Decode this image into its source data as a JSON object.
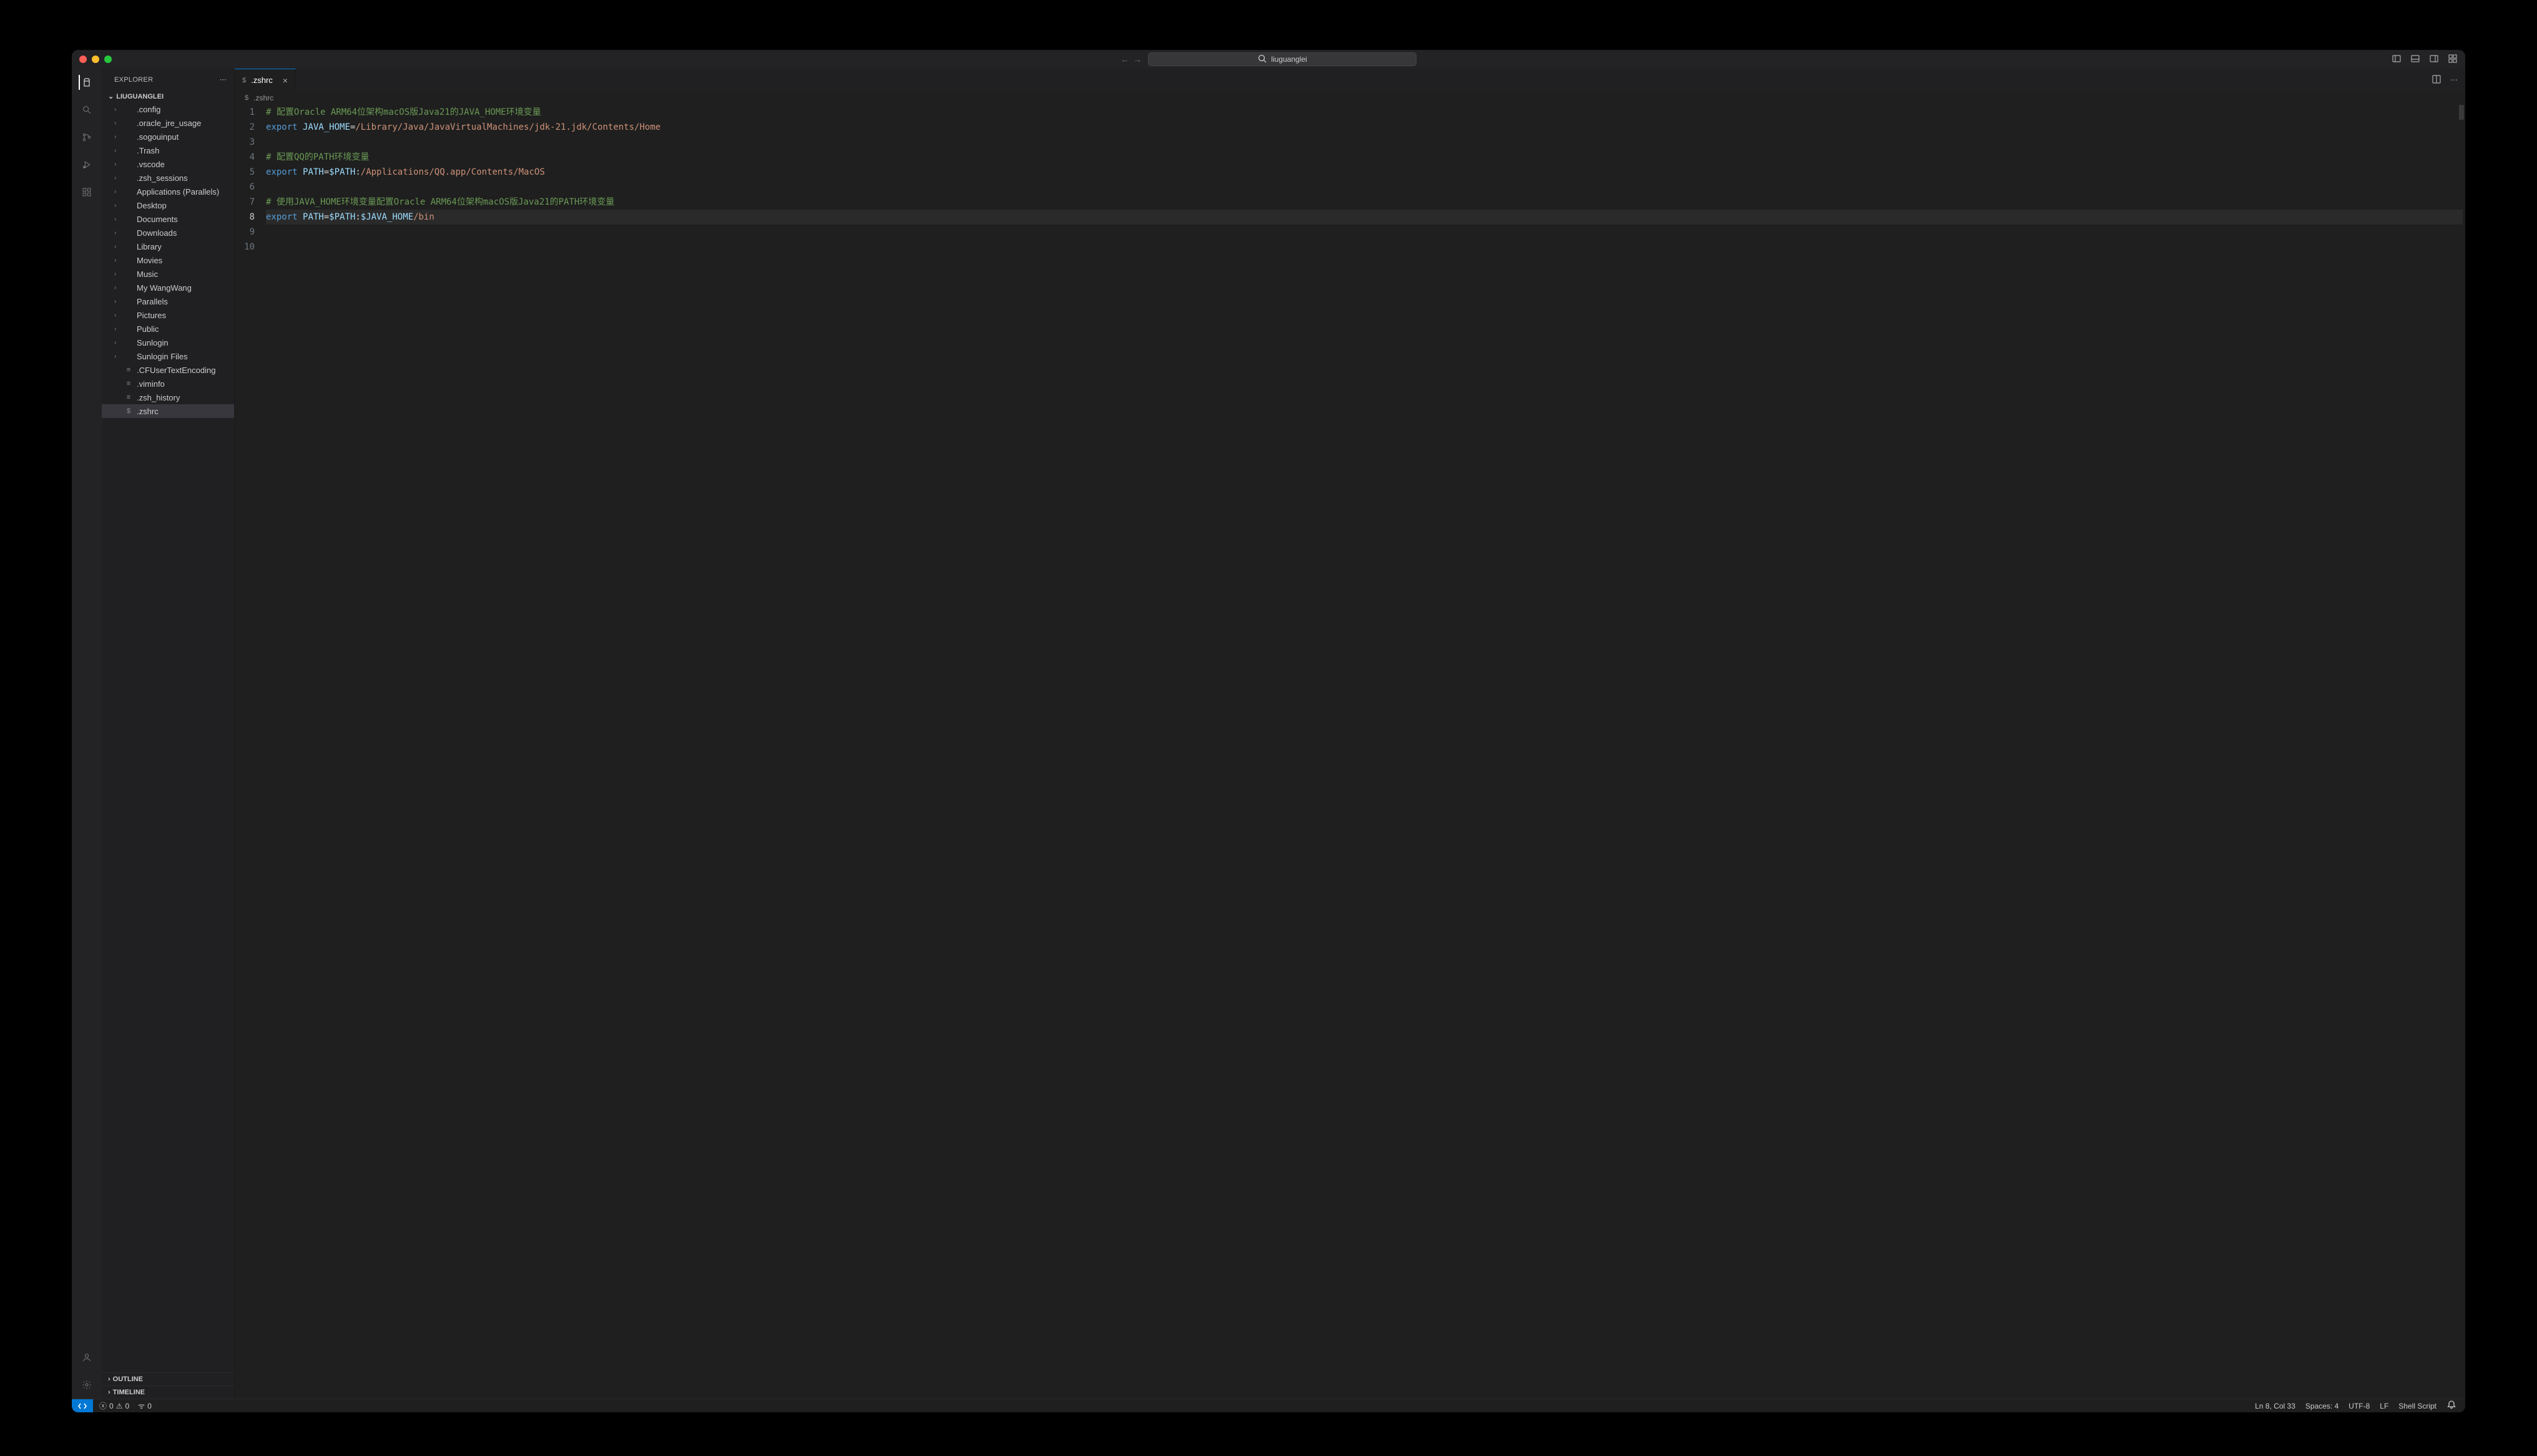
{
  "titlebar": {
    "search_text": "liuguanglei"
  },
  "sidebar": {
    "header": "EXPLORER",
    "root": "LIUGUANGLEI",
    "tree": [
      {
        "type": "folder",
        "label": ".config"
      },
      {
        "type": "folder",
        "label": ".oracle_jre_usage"
      },
      {
        "type": "folder",
        "label": ".sogouinput"
      },
      {
        "type": "folder",
        "label": ".Trash"
      },
      {
        "type": "folder",
        "label": ".vscode"
      },
      {
        "type": "folder",
        "label": ".zsh_sessions"
      },
      {
        "type": "folder",
        "label": "Applications (Parallels)"
      },
      {
        "type": "folder",
        "label": "Desktop"
      },
      {
        "type": "folder",
        "label": "Documents"
      },
      {
        "type": "folder",
        "label": "Downloads"
      },
      {
        "type": "folder",
        "label": "Library"
      },
      {
        "type": "folder",
        "label": "Movies"
      },
      {
        "type": "folder",
        "label": "Music"
      },
      {
        "type": "folder",
        "label": "My WangWang"
      },
      {
        "type": "folder",
        "label": "Parallels"
      },
      {
        "type": "folder",
        "label": "Pictures"
      },
      {
        "type": "folder",
        "label": "Public"
      },
      {
        "type": "folder",
        "label": "Sunlogin"
      },
      {
        "type": "folder",
        "label": "Sunlogin Files"
      },
      {
        "type": "file",
        "label": ".CFUserTextEncoding"
      },
      {
        "type": "file",
        "label": ".viminfo"
      },
      {
        "type": "file",
        "label": ".zsh_history"
      },
      {
        "type": "file",
        "label": ".zshrc",
        "selected": true,
        "shell": true
      }
    ],
    "sections": [
      "OUTLINE",
      "TIMELINE"
    ]
  },
  "tabs": {
    "active": {
      "label": ".zshrc"
    }
  },
  "breadcrumb": {
    "file": ".zshrc"
  },
  "editor": {
    "current_line": 8,
    "lines": [
      {
        "n": 1,
        "t": "comment",
        "text": "# 配置Oracle ARM64位架构macOS版Java21的JAVA_HOME环境变量"
      },
      {
        "n": 2,
        "t": "export",
        "var": "JAVA_HOME",
        "op": "=",
        "val": "/Library/Java/JavaVirtualMachines/jdk-21.jdk/Contents/Home"
      },
      {
        "n": 3,
        "t": "blank"
      },
      {
        "n": 4,
        "t": "comment",
        "text": "# 配置QQ的PATH环境变量"
      },
      {
        "n": 5,
        "t": "export",
        "var": "PATH",
        "op": "=",
        "ref": "$PATH",
        "sep": ":",
        "val": "/Applications/QQ.app/Contents/MacOS"
      },
      {
        "n": 6,
        "t": "blank"
      },
      {
        "n": 7,
        "t": "comment",
        "text": "# 使用JAVA_HOME环境变量配置Oracle ARM64位架构macOS版Java21的PATH环境变量"
      },
      {
        "n": 8,
        "t": "export",
        "var": "PATH",
        "op": "=",
        "ref": "$PATH",
        "sep": ":",
        "ref2": "$JAVA_HOME",
        "val": "/bin"
      },
      {
        "n": 9,
        "t": "blank"
      },
      {
        "n": 10,
        "t": "blank"
      }
    ]
  },
  "status": {
    "errors": "0",
    "warnings": "0",
    "ports": "0",
    "cursor": "Ln 8, Col 33",
    "spaces": "Spaces: 4",
    "encoding": "UTF-8",
    "eol": "LF",
    "language": "Shell Script"
  }
}
